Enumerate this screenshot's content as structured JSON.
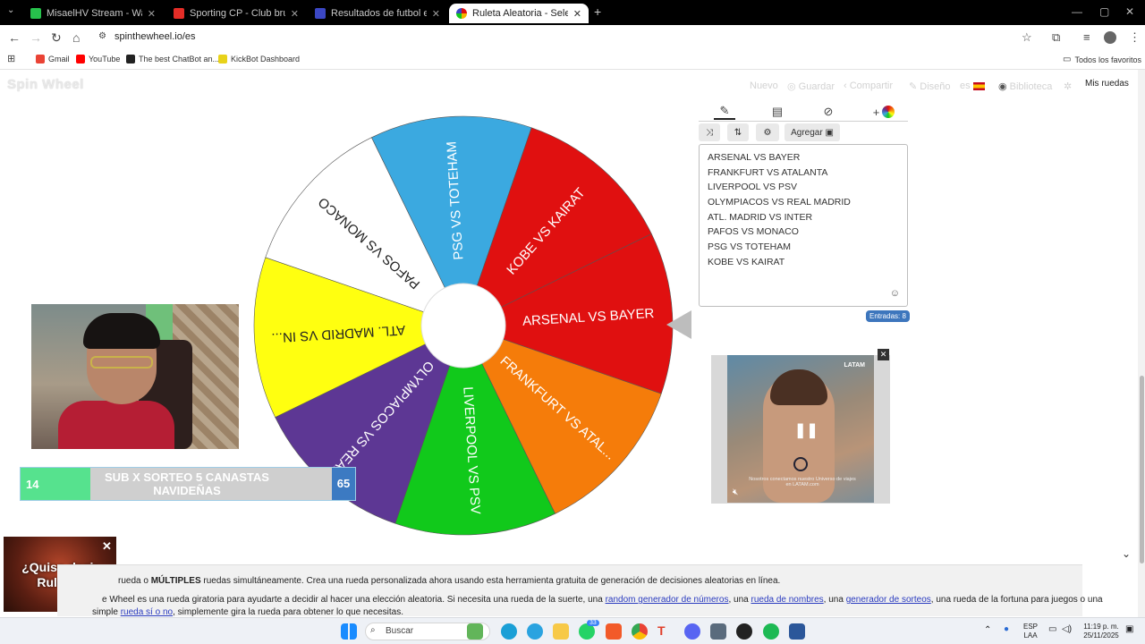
{
  "browser": {
    "tabs": [
      {
        "title": "MisaelHV Stream - Watch Live o",
        "color": "#27c24c"
      },
      {
        "title": "Sporting CP - Club brugge KV",
        "color": "#e52d27"
      },
      {
        "title": "Resultados de futbol en directo",
        "color": "#3b47c4"
      },
      {
        "title": "Ruleta Aleatoria - Selector",
        "color": "#f4b400"
      }
    ],
    "url": "spinthewheel.io/es",
    "bookmarks": [
      "Gmail",
      "YouTube",
      "The best ChatBot an...",
      "KickBot Dashboard"
    ],
    "all_bookmarks": "Todos los favoritos"
  },
  "site": {
    "logo": "Spin Wheel",
    "nav": [
      "Nuevo",
      "Guardar",
      "Compartir",
      "Diseño",
      "es",
      "Biblioteca"
    ],
    "my_wheels": "Mis ruedas"
  },
  "wheel": {
    "segments": [
      {
        "label": "ARSENAL VS BAYER",
        "color": "#e01010"
      },
      {
        "label": "FRANKFURT VS ATAL...",
        "color": "#f57c0a"
      },
      {
        "label": "LIVERPOOL VS PSV",
        "color": "#11c91b"
      },
      {
        "label": "OLYMPIACOS VS REA...",
        "color": "#5d3794"
      },
      {
        "label": "ATL. MADRID VS IN...",
        "color": "#ffff10"
      },
      {
        "label": "PAFOS VS MONACO",
        "color": "#ffffff"
      },
      {
        "label": "PSG VS TOTEHAM",
        "color": "#3ba9e0"
      },
      {
        "label": "KOBE VS KAIRAT",
        "color": "#e01010"
      }
    ]
  },
  "editor": {
    "add_button": "Agregar",
    "entries": [
      "ARSENAL VS BAYER",
      "FRANKFURT VS ATALANTA",
      "LIVERPOOL VS PSV",
      "OLYMPIACOS VS REAL MADRID",
      "ATL. MADRID VS INTER",
      "PAFOS VS MONACO",
      "PSG VS TOTEHAM",
      "KOBE VS KAIRAT"
    ],
    "count_label": "Entradas: 8"
  },
  "ad": {
    "brand": "LATAM",
    "caption": "Nosotros conectamos nuestro Universo de viajes en LATAM.com"
  },
  "overlay": {
    "sub_left": "14",
    "sub_text": "SUB X SORTEO 5 CANASTAS NAVIDEÑAS",
    "sub_right": "65",
    "roulette_ad": "¿Quiso decir Ruleta?"
  },
  "info": {
    "line1_prefix": "rueda o ",
    "line1_bold": "MÚLTIPLES",
    "line1_rest": " ruedas simultáneamente. Crea una rueda personalizada ahora usando esta herramienta gratuita de generación de decisiones aleatorias en línea.",
    "line2_a": "e Wheel es una rueda giratoria para ayudarte a decidir al hacer una elección aleatoria. Si necesita una rueda de la suerte, una ",
    "link1": "random generador de números",
    "line2_b": ", una ",
    "link2": "rueda de nombres",
    "line2_c": ", una ",
    "link3": "generador de sorteos",
    "line2_d": ", una rueda de la fortuna para juegos o una",
    "line3_a": "simple ",
    "link4": "rueda sí o no",
    "line3_b": ", simplemente gira la rueda para obtener lo que necesitas."
  },
  "taskbar": {
    "search": "Buscar",
    "lang_top": "ESP",
    "lang_bottom": "LAA",
    "time": "11:19 p. m.",
    "date": "25/11/2025",
    "badge": "33"
  }
}
